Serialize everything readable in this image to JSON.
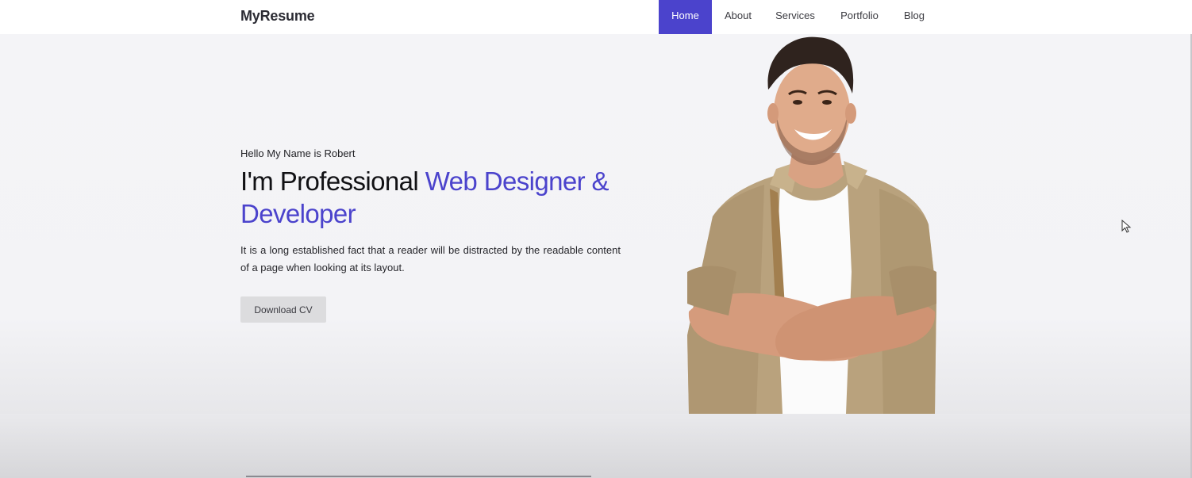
{
  "brand": {
    "name": "MyResume"
  },
  "nav": {
    "items": [
      {
        "label": "Home",
        "active": true
      },
      {
        "label": "About",
        "active": false
      },
      {
        "label": "Services",
        "active": false
      },
      {
        "label": "Portfolio",
        "active": false
      },
      {
        "label": "Blog",
        "active": false
      }
    ]
  },
  "hero": {
    "greeting": "Hello My Name is Robert",
    "headline_plain": "I'm Professional ",
    "headline_accent": "Web Designer & Developer",
    "description": "It is a long established fact that a reader will be distracted by the readable content of a page when looking at its layout.",
    "cta_label": "Download CV"
  },
  "colors": {
    "accent": "#4b43cc",
    "background": "#f3f3f5",
    "navbar": "#ffffff",
    "button": "#dcdcde"
  },
  "icons": {
    "cursor": "mouse-pointer-icon"
  }
}
